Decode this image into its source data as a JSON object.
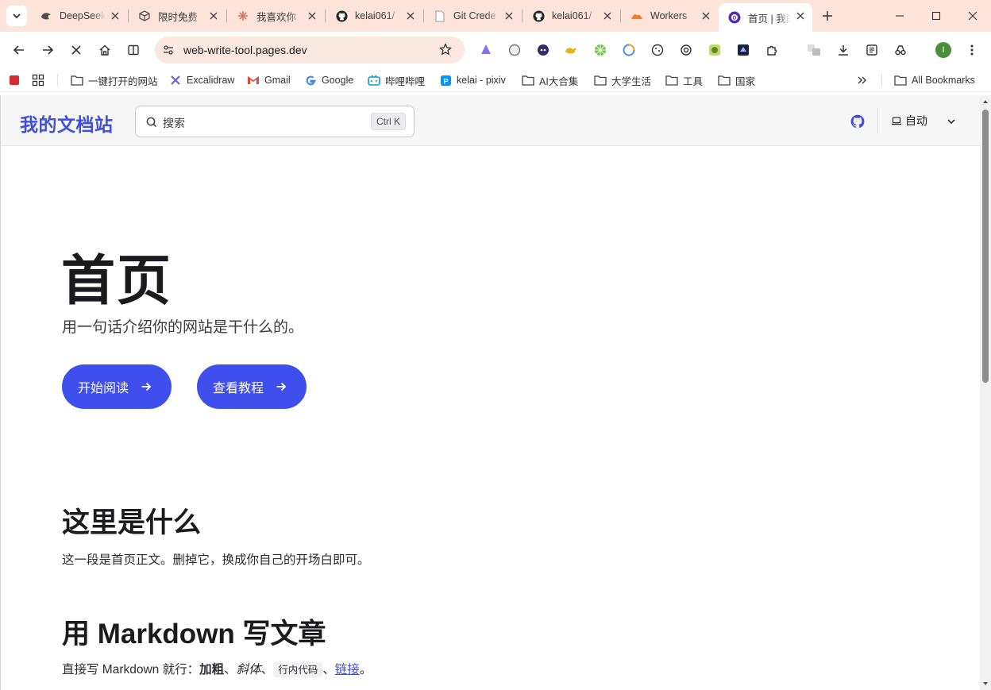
{
  "browser": {
    "tabs": [
      {
        "title": "DeepSeek",
        "icon": "deepseek-icon"
      },
      {
        "title": "限时免费",
        "icon": "cube-icon"
      },
      {
        "title": "我喜欢你",
        "icon": "claude-icon"
      },
      {
        "title": "kelai061/",
        "icon": "github-icon"
      },
      {
        "title": "Git Crede",
        "icon": "page-icon"
      },
      {
        "title": "kelai061/",
        "icon": "github-icon"
      },
      {
        "title": "Workers",
        "icon": "cloudflare-icon"
      },
      {
        "title": "首页 | 我的",
        "icon": "docs-site-icon",
        "active": true
      }
    ],
    "url": "web-write-tool.pages.dev",
    "profile_initial": "I",
    "bookmarks": [
      {
        "label": "",
        "icon": "red-square-icon"
      },
      {
        "label": "",
        "icon": "apps-grid-icon"
      },
      {
        "label": "一键打开的网站",
        "icon": "folder-icon"
      },
      {
        "label": "Excalidraw",
        "icon": "excalidraw-icon"
      },
      {
        "label": "Gmail",
        "icon": "gmail-icon"
      },
      {
        "label": "Google",
        "icon": "google-icon"
      },
      {
        "label": "哔哩哔哩",
        "icon": "bilibili-icon"
      },
      {
        "label": "kelai - pixiv",
        "icon": "pixiv-icon"
      },
      {
        "label": "AI大合集",
        "icon": "folder-icon"
      },
      {
        "label": "大学生活",
        "icon": "folder-icon"
      },
      {
        "label": "工具",
        "icon": "folder-icon"
      },
      {
        "label": "国家",
        "icon": "folder-icon"
      },
      {
        "label": "All Bookmarks",
        "icon": "folder-icon"
      }
    ],
    "accent": "#fde3d9"
  },
  "site": {
    "logo": "我的文档站",
    "search_label": "搜索",
    "search_shortcut": "Ctrl K",
    "theme_label": "自动",
    "brand_color": "#3e4fe0"
  },
  "hero": {
    "title": "首页",
    "subtitle": "用一句话介绍你的网站是干什么的。",
    "primary_button": "开始阅读",
    "secondary_button": "查看教程"
  },
  "sections": [
    {
      "heading": "这里是什么",
      "body": "这一段是首页正文。删掉它，换成你自己的开场白即可。"
    },
    {
      "heading": "用 Markdown 写文章",
      "body_prefix": "直接写 Markdown 就行：",
      "bold": "加粗",
      "sep1": "、",
      "italic": "斜体",
      "sep2": "、",
      "code": "行内代码",
      "sep3": "、",
      "link": "链接",
      "end": "。"
    }
  ]
}
